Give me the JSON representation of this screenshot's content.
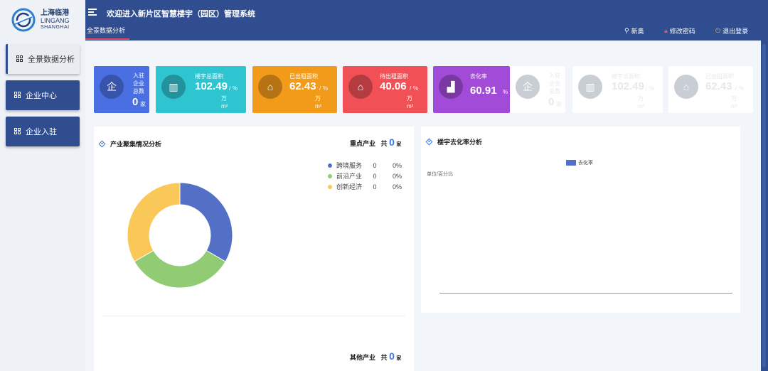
{
  "logo": {
    "cn": "上海临港",
    "en": "LINGANG",
    "city": "SHANGHAI"
  },
  "header": {
    "title": "欢迎进入新片区智慧楼宇（园区）管理系统",
    "tab": "全景数据分析",
    "user": "新奥",
    "change_password": "修改密码",
    "logout": "退出登录"
  },
  "sidebar": {
    "items": [
      {
        "label": "全景数据分析"
      },
      {
        "label": "企业中心"
      },
      {
        "label": "企业入驻"
      }
    ]
  },
  "cards": [
    {
      "label_lines": [
        "入驻",
        "企业",
        "总数"
      ],
      "value": "0",
      "unit": "家",
      "color": "#4a6fe3"
    },
    {
      "label": "楼宇总面积",
      "value": "102.49",
      "unit_a": "/ ％",
      "unit_b": "万",
      "unit_c": "m²",
      "color": "#2ec4d0"
    },
    {
      "label": "已出租面积",
      "value": "62.43",
      "unit_a": "/ ％",
      "unit_b": "万",
      "unit_c": "m²",
      "color": "#f29a1a"
    },
    {
      "label": "待出租面积",
      "value": "40.06",
      "unit_a": "/ ％",
      "unit_b": "万",
      "unit_c": "m²",
      "color": "#f05056"
    },
    {
      "label": "去化率",
      "value": "60.91",
      "unit": "%",
      "color": "#a24bd8"
    }
  ],
  "ghost_cards": [
    {
      "label_lines": [
        "入驻",
        "企业",
        "总数"
      ],
      "value": "0",
      "unit": "家"
    },
    {
      "label": "楼宇总面积",
      "value": "102.49",
      "unit_a": "/ ％",
      "unit_b": "万",
      "unit_c": "m²"
    },
    {
      "label": "已出租面积",
      "value": "62.43",
      "unit_a": "/ ％",
      "unit_b": "万",
      "unit_c": "m²"
    }
  ],
  "industry": {
    "title": "产业聚集情况分析",
    "key_label": "重点产业",
    "key_total_prefix": "共",
    "key_total": "0",
    "key_unit": "家",
    "other_label": "其他产业",
    "other_total": "0",
    "other_unit": "家"
  },
  "building": {
    "title": "楼宇去化率分析",
    "legend": "去化率",
    "unit_label": "单位/百分比"
  },
  "chart_data": {
    "type": "pie",
    "title": "",
    "categories": [
      "跨境服务",
      "前沿产业",
      "创新经济"
    ],
    "values": [
      0,
      0,
      0
    ],
    "percents": [
      "0%",
      "0%",
      "0%"
    ],
    "colors": [
      "#5470c6",
      "#91cc75",
      "#fac858"
    ]
  }
}
